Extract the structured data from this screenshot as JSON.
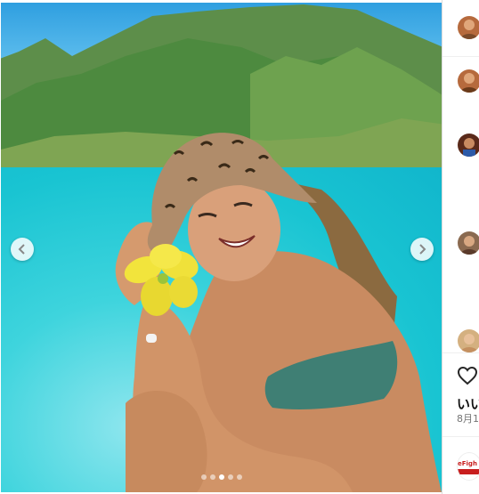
{
  "post": {
    "carousel": {
      "prev_icon": "chevron-left-icon",
      "next_icon": "chevron-right-icon",
      "slides_total": 5,
      "active_slide": 3
    }
  },
  "sidebar": {
    "likes_label": "いい",
    "date_label": "8月1",
    "heart_icon": "heart-icon",
    "ad_text": "eFigh"
  },
  "colors": {
    "water": "#1fd0d6",
    "sky": "#5ec4ec",
    "hat_print": "#b08c6a",
    "bikini": "#3f7f74",
    "flower": "#f2e43c"
  }
}
